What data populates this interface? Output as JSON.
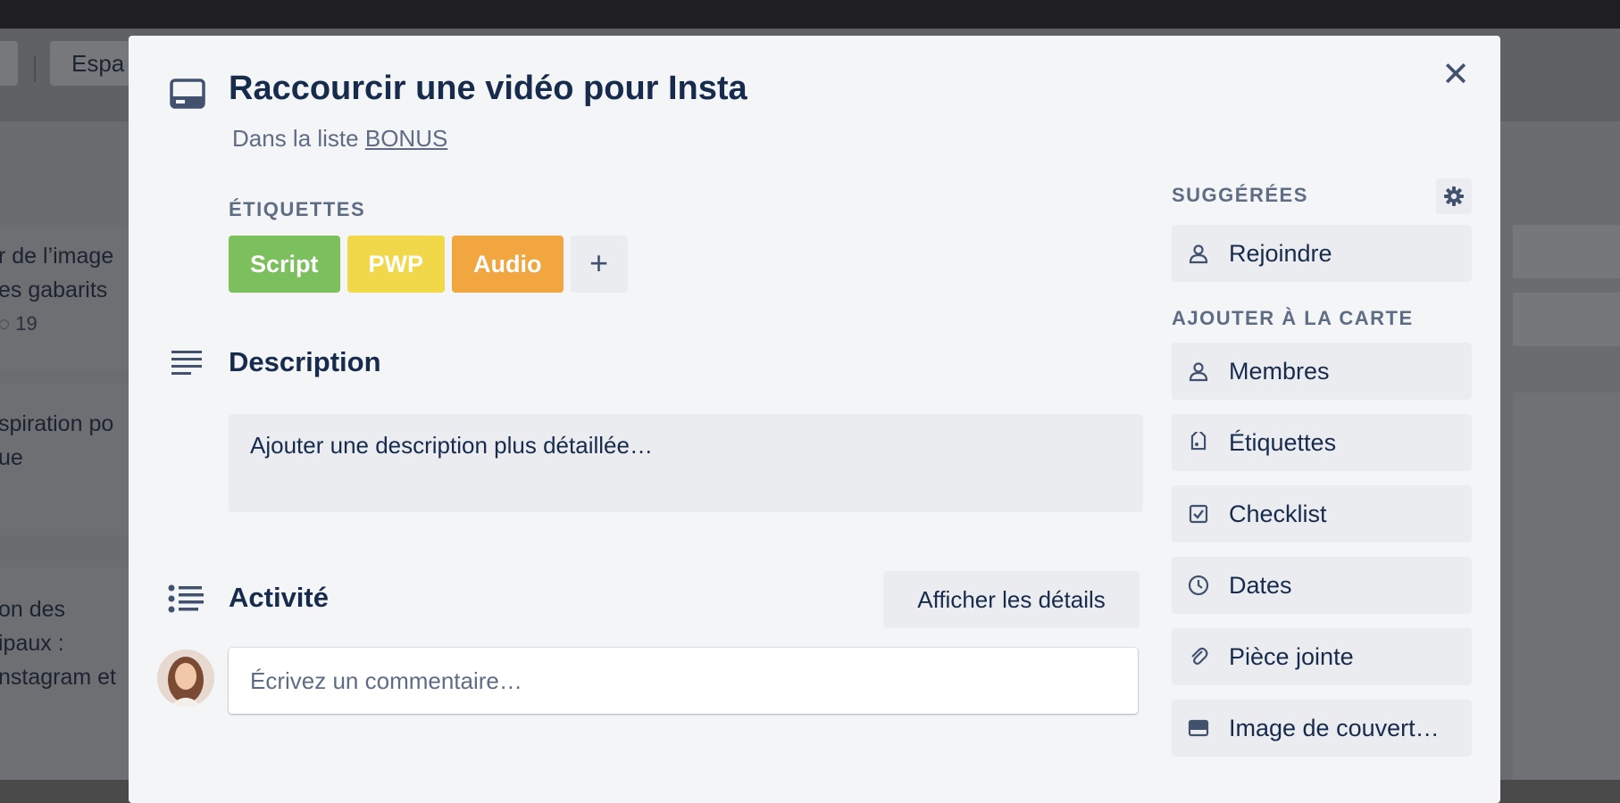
{
  "board": {
    "workspace_label": "Espa",
    "bg_cards": [
      {
        "line1": "r de l’image",
        "line2": "es gabarits",
        "comments": "19"
      },
      {
        "line1": "spiration po",
        "line2": "ue"
      },
      {
        "line1": "on des",
        "line2": "ipaux :",
        "line3": "nstagram et"
      }
    ]
  },
  "card": {
    "title": "Raccourcir une vidéo pour Insta",
    "in_list_prefix": "Dans la liste",
    "list_name": "BONUS",
    "close_icon": "close-icon"
  },
  "labels": {
    "heading": "ÉTIQUETTES",
    "items": [
      {
        "text": "Script",
        "color": "#7bc05c"
      },
      {
        "text": "PWP",
        "color": "#f0d84a"
      },
      {
        "text": "Audio",
        "color": "#f2a640"
      }
    ],
    "add_symbol": "+"
  },
  "description": {
    "heading": "Description",
    "placeholder": "Ajouter une description plus détaillée…"
  },
  "activity": {
    "heading": "Activité",
    "details_button": "Afficher les détails",
    "comment_placeholder": "Écrivez un commentaire…"
  },
  "sidebar": {
    "suggested_heading": "SUGGÉRÉES",
    "join": "Rejoindre",
    "add_heading": "AJOUTER À LA CARTE",
    "items": [
      {
        "label": "Membres",
        "icon": "person-icon"
      },
      {
        "label": "Étiquettes",
        "icon": "tag-icon"
      },
      {
        "label": "Checklist",
        "icon": "checkbox-icon"
      },
      {
        "label": "Dates",
        "icon": "clock-icon"
      },
      {
        "label": "Pièce jointe",
        "icon": "paperclip-icon"
      },
      {
        "label": "Image de couvert…",
        "icon": "cover-icon"
      }
    ]
  }
}
